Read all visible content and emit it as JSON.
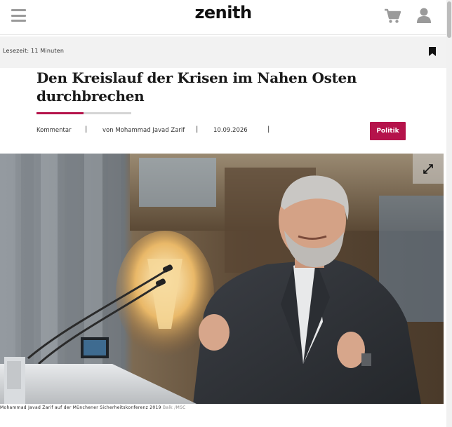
{
  "header": {
    "logo": "zenith",
    "menu_icon": "hamburger-menu-icon",
    "cart_icon": "shopping-cart-icon",
    "user_icon": "user-icon"
  },
  "reading": {
    "time_label": "Lesezeit: 11 Minuten",
    "bookmark_icon": "bookmark-icon"
  },
  "article": {
    "title": "Den Kreislauf der Krisen im Nahen Osten durchbrechen",
    "type": "Kommentar",
    "author": "von Mohammad Javad Zarif",
    "date": "10.09.2026",
    "separator": "|",
    "category": "Politik"
  },
  "image": {
    "expand_icon": "expand-icon",
    "caption": "Mohammad Javad Zarif auf der Münchener Sicherheitskonferenz 2019",
    "credit": "Balk /MSC"
  },
  "colors": {
    "accent": "#b5134b",
    "icon_gray": "#9a9a9a",
    "readbar_bg": "#f2f2f2"
  }
}
